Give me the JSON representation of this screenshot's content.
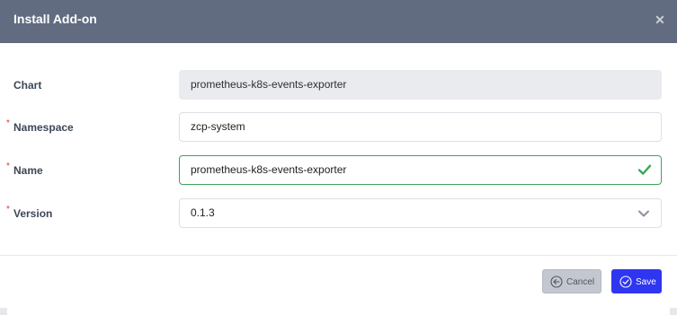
{
  "dialog": {
    "title": "Install Add-on",
    "close_icon": "close-icon"
  },
  "form": {
    "chart": {
      "label": "Chart",
      "value": "prometheus-k8s-events-exporter",
      "disabled": true
    },
    "namespace": {
      "label": "Namespace",
      "required": true,
      "required_mark": "*",
      "value": "zcp-system"
    },
    "name": {
      "label": "Name",
      "required": true,
      "required_mark": "*",
      "value": "prometheus-k8s-events-exporter",
      "status": "valid",
      "status_icon": "check-icon"
    },
    "version": {
      "label": "Version",
      "required": true,
      "required_mark": "*",
      "value": "0.1.3",
      "control": "select",
      "icon": "chevron-down-icon"
    }
  },
  "footer": {
    "cancel_label": "Cancel",
    "cancel_icon": "arrow-left-circle-icon",
    "save_label": "Save",
    "save_icon": "check-circle-icon"
  },
  "colors": {
    "header": "#616c80",
    "required": "#e0353b",
    "valid": "#3ba55c",
    "primary": "#2f36f0"
  }
}
